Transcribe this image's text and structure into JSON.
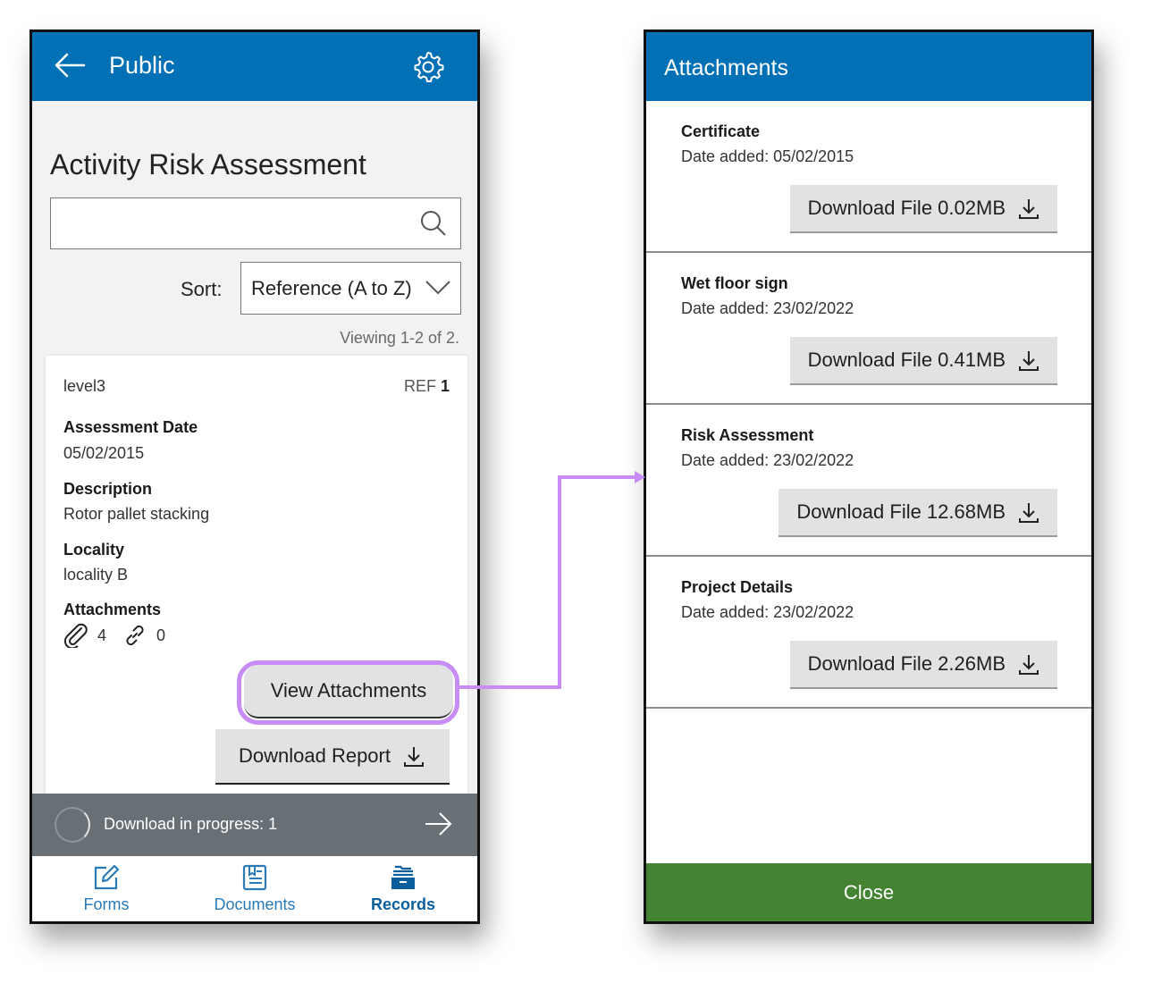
{
  "left_screen": {
    "header": {
      "back_icon": "arrow-left-icon",
      "title": "Public",
      "settings_icon": "gear-icon"
    },
    "page_title": "Activity Risk Assessment",
    "search": {
      "value": "",
      "placeholder": "",
      "icon": "search-icon"
    },
    "sort": {
      "label": "Sort:",
      "selected": "Reference (A to Z)",
      "icon": "chevron-down-icon"
    },
    "viewing": "Viewing 1-2 of 2.",
    "record": {
      "level": "level3",
      "ref_label": "REF",
      "ref_value": "1",
      "fields": [
        {
          "label": "Assessment Date",
          "value": "05/02/2015"
        },
        {
          "label": "Description",
          "value": "Rotor pallet stacking"
        },
        {
          "label": "Locality",
          "value": "locality B"
        }
      ],
      "attachments_label": "Attachments",
      "attachment_count": "4",
      "link_count": "0",
      "view_attachments_label": "View Attachments",
      "download_report_label": "Download Report"
    },
    "progress": {
      "text": "Download in progress: 1",
      "icon": "arrow-right-icon"
    },
    "bottom_nav": [
      {
        "label": "Forms",
        "icon": "edit-icon",
        "active": false
      },
      {
        "label": "Documents",
        "icon": "document-icon",
        "active": false
      },
      {
        "label": "Records",
        "icon": "records-drawer-icon",
        "active": true
      }
    ]
  },
  "right_screen": {
    "title": "Attachments",
    "items": [
      {
        "name": "Certificate",
        "date": "Date added: 05/02/2015",
        "button": "Download File 0.02MB"
      },
      {
        "name": "Wet floor sign",
        "date": "Date added: 23/02/2022",
        "button": "Download File 0.41MB"
      },
      {
        "name": "Risk Assessment",
        "date": "Date added: 23/02/2022",
        "button": "Download File 12.68MB"
      },
      {
        "name": "Project Details",
        "date": "Date added: 23/02/2022",
        "button": "Download File 2.26MB"
      }
    ],
    "close_label": "Close"
  },
  "colors": {
    "header_blue": "#0170b5",
    "highlight_purple": "#c78cf6",
    "close_green": "#438331",
    "progress_grey": "#687075"
  }
}
